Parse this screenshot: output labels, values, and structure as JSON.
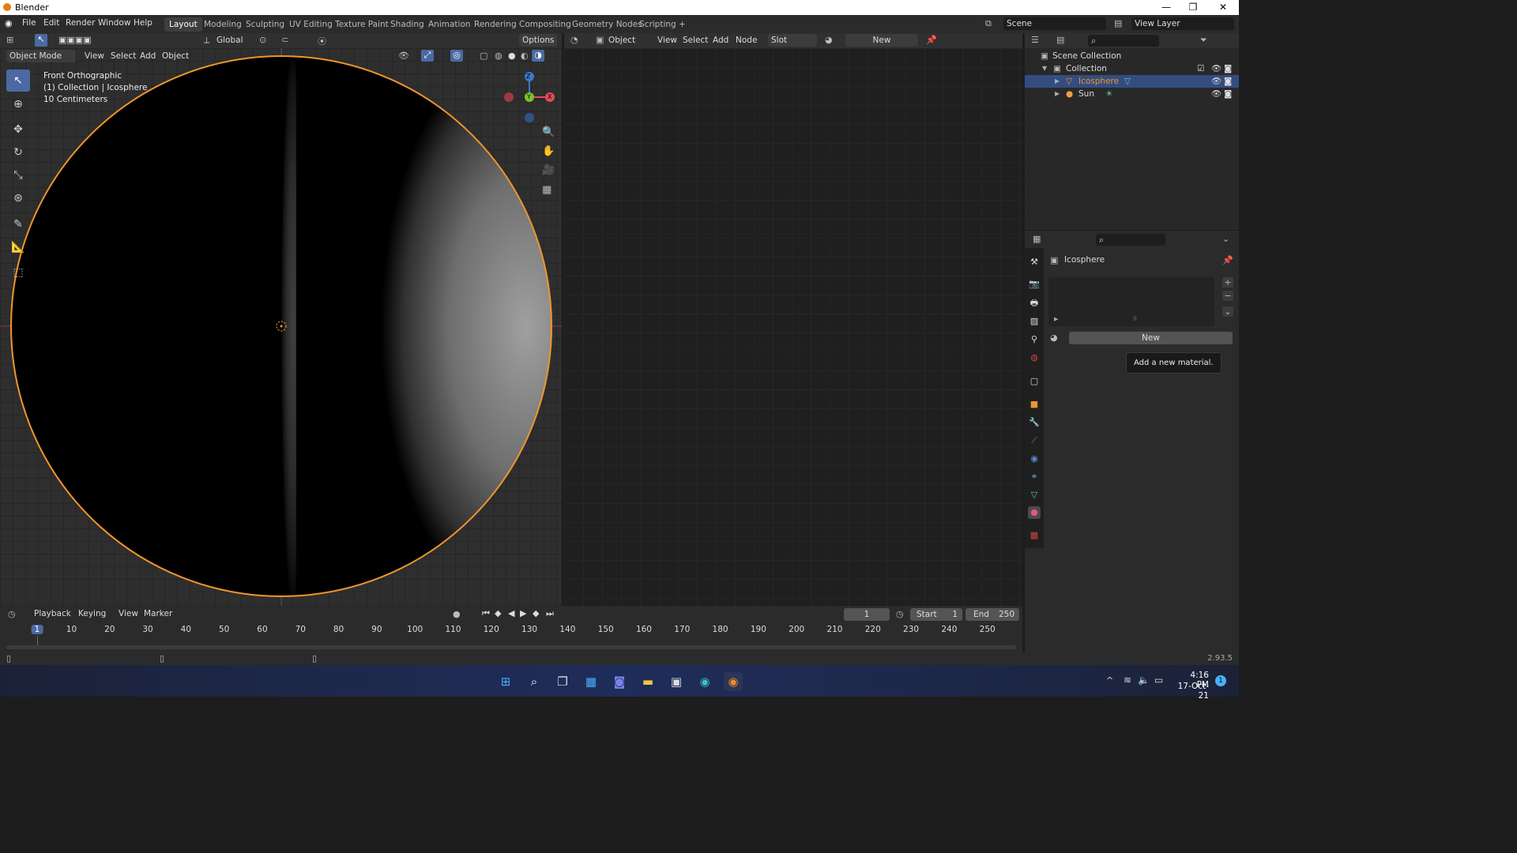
{
  "window": {
    "title": "Blender",
    "min": "—",
    "max": "❐",
    "close": "✕"
  },
  "menu": [
    "File",
    "Edit",
    "Render",
    "Window",
    "Help"
  ],
  "workspaces": [
    "Layout",
    "Modeling",
    "Sculpting",
    "UV Editing",
    "Texture Paint",
    "Shading",
    "Animation",
    "Rendering",
    "Compositing",
    "Geometry Nodes",
    "Scripting"
  ],
  "workspace_add": "+",
  "scene": {
    "name": "Scene",
    "view_layer": "View Layer"
  },
  "viewport_header": {
    "orientation": "Global",
    "options": "Options",
    "mode": "Object Mode",
    "menus": [
      "View",
      "Select",
      "Add",
      "Object"
    ]
  },
  "viewport_overlay": {
    "view": "Front Orthographic",
    "collection": "(1) Collection | Icosphere",
    "scale": "10 Centimeters"
  },
  "gizmo": {
    "z": "Z",
    "y": "Y",
    "x": "X"
  },
  "node_header": {
    "type": "Object",
    "menus": [
      "View",
      "Select",
      "Add",
      "Node"
    ],
    "slot": "Slot",
    "new": "New"
  },
  "outliner": {
    "root": "Scene Collection",
    "collection": "Collection",
    "items": [
      {
        "name": "Icosphere",
        "selected": true
      },
      {
        "name": "Sun",
        "selected": false
      }
    ]
  },
  "properties": {
    "object_name": "Icosphere",
    "new_button": "New",
    "tooltip": "Add a new material."
  },
  "timeline": {
    "menus": [
      "Playback",
      "Keying",
      "View",
      "Marker"
    ],
    "current_frame": "1",
    "start_label": "Start",
    "start": "1",
    "end_label": "End",
    "end": "250",
    "ticks": [
      "1",
      "10",
      "20",
      "30",
      "40",
      "50",
      "60",
      "70",
      "80",
      "90",
      "100",
      "110",
      "120",
      "130",
      "140",
      "150",
      "160",
      "170",
      "180",
      "190",
      "200",
      "210",
      "220",
      "230",
      "240",
      "250"
    ]
  },
  "status": {
    "version": "2.93.5"
  },
  "taskbar": {
    "time": "4:16 PM",
    "date": "17-Oct-21",
    "notifications": "1"
  },
  "colors": {
    "accent": "#4b6aa3",
    "selection_outline": "#f0952c",
    "gizmo_x": "#e04a5a",
    "gizmo_y": "#7cc22a",
    "gizmo_z": "#3c78c8"
  }
}
